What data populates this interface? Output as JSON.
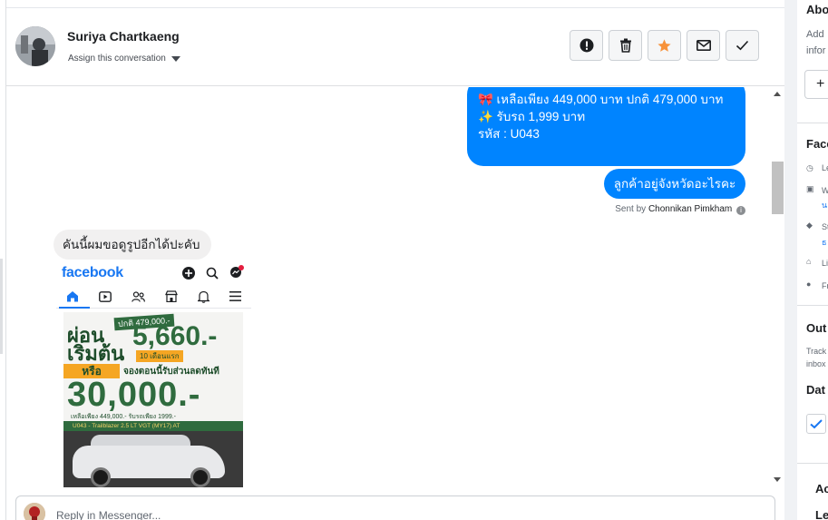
{
  "header": {
    "contact_name": "Suriya Chartkaeng",
    "assign_label": "Assign this conversation",
    "actions": [
      "mark-spam",
      "delete",
      "star",
      "mark-unread",
      "done"
    ]
  },
  "thread": {
    "outgoing_1": {
      "line1": "🎀  เหลือเพียง 449,000 บาท ปกติ 479,000 บาท",
      "line2": "✨ รับรถ 1,999 บาท",
      "line3": "รหัส : U043"
    },
    "outgoing_2": "ลูกค้าอยู่จังหวัดอะไรคะ",
    "sent_by_prefix": "Sent by",
    "sent_by_name": "Chonnikan Pimkham",
    "incoming_1": "คันนี้ผมขอดูรูปอีกได้ปะคับ",
    "attachment": {
      "app_name": "facebook",
      "promo_old_price": "ปกติ 479,000.-",
      "promo_line1": "ผ่อน",
      "promo_line2": "เริ่มต้น",
      "promo_monthly": "5,660.-",
      "promo_tag": "10 เดือนแรก",
      "promo_or": "หรือ",
      "promo_mid": "จองตอนนี้รับส่วนลดทันที",
      "promo_discount": "30,000.-",
      "promo_sub": "เหลือเพียง 449,000.- รับรถเพียง 1999.-",
      "promo_strip": "U043 - Trailblazer 2.5 LT VGT (MY17) AT"
    }
  },
  "composer": {
    "placeholder": "Reply in Messenger..."
  },
  "right_panel": {
    "about_title": "Abo",
    "about_text1": "Add",
    "about_text2": "infor",
    "add_button": "+",
    "facebook_title": "Face",
    "fields": [
      "Le",
      "W",
      "St",
      "Li",
      "Fr"
    ],
    "field_link1": "น",
    "field_link2": "ธ",
    "outcome_title": "Out",
    "outcome_text1": "Track",
    "outcome_text2": "inbox",
    "date_title": "Dat",
    "bottom1": "Ac",
    "bottom2": "Le"
  },
  "colors": {
    "messenger_blue": "#0084ff",
    "facebook_blue": "#1877f2",
    "star_orange": "#f7923a",
    "incoming_bubble": "#f1f0f0"
  }
}
